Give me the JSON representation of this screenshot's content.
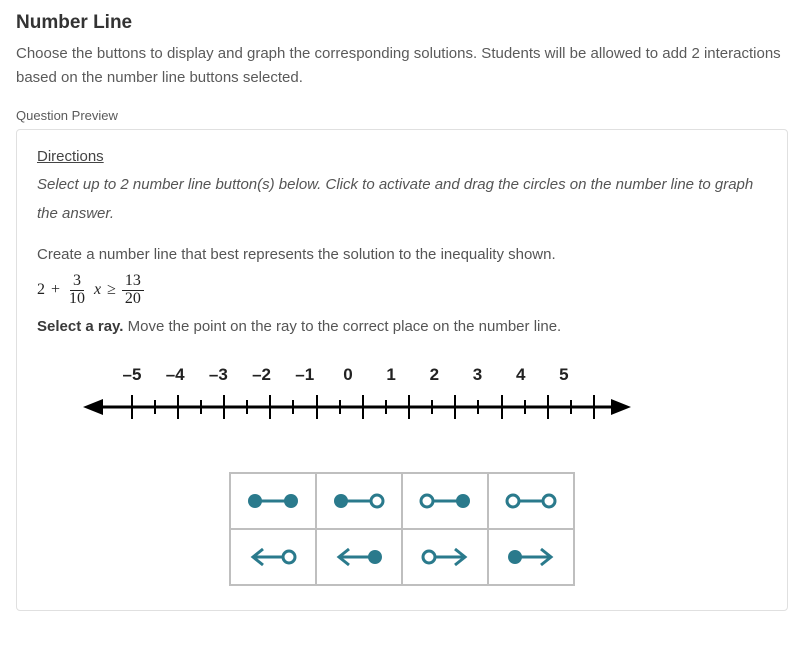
{
  "header": {
    "title": "Number Line",
    "subtitle": "Choose the buttons to display and graph the corresponding solutions. Students will be allowed to add 2 interactions based on the number line buttons selected."
  },
  "preview_label": "Question Preview",
  "directions": {
    "heading": "Directions",
    "body": "Select up to 2 number line button(s) below. Click to activate and drag the circles on the number line to graph the answer."
  },
  "question": {
    "prompt": "Create a number line that best represents the solution to the inequality shown.",
    "math": {
      "lhs_const": "2",
      "plus": "+",
      "frac1_num": "3",
      "frac1_den": "10",
      "variable": "x",
      "relation": "≥",
      "frac2_num": "13",
      "frac2_den": "20"
    },
    "instruction_bold": "Select a ray.",
    "instruction_rest": " Move the point on the ray to the correct place on the number line."
  },
  "numberline": {
    "labels": [
      "–5",
      "–4",
      "–3",
      "–2",
      "–1",
      "0",
      "1",
      "2",
      "3",
      "4",
      "5"
    ]
  },
  "tools": {
    "row1": [
      "segment-closed-closed",
      "segment-closed-open",
      "segment-open-closed",
      "segment-open-open"
    ],
    "row2": [
      "ray-left-open",
      "ray-left-closed",
      "ray-right-open",
      "ray-right-closed"
    ]
  },
  "colors": {
    "tool": "#2a7a8c"
  }
}
